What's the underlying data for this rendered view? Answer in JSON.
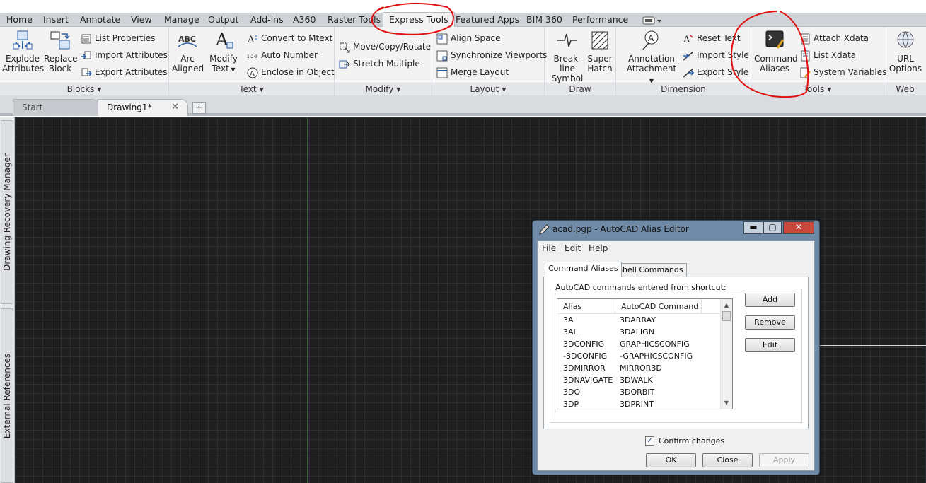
{
  "ribbon_tabs": [
    {
      "label": "Home"
    },
    {
      "label": "Insert"
    },
    {
      "label": "Annotate"
    },
    {
      "label": "View"
    },
    {
      "label": "Manage"
    },
    {
      "label": "Output"
    },
    {
      "label": "Add-ins"
    },
    {
      "label": "A360"
    },
    {
      "label": "Raster Tools"
    },
    {
      "label": "Express Tools",
      "active": true
    },
    {
      "label": "Featured Apps"
    },
    {
      "label": "BIM 360"
    },
    {
      "label": "Performance"
    }
  ],
  "panels": {
    "blocks": {
      "title": "Blocks",
      "explode": "Explode\nAttributes",
      "explode_l1": "Explode",
      "explode_l2": "Attributes",
      "replace_l1": "Replace",
      "replace_l2": "Block",
      "list_properties": "List Properties",
      "import_attributes": "Import Attributes",
      "export_attributes": "Export Attributes"
    },
    "text": {
      "title": "Text",
      "arc_l1": "Arc",
      "arc_l2": "Aligned",
      "modify_l1": "Modify",
      "modify_l2": "Text",
      "convert_mtext": "Convert to Mtext",
      "auto_number": "Auto Number",
      "enclose": "Enclose in Object",
      "abc": "ABC"
    },
    "modify": {
      "title": "Modify",
      "move_copy_rotate": "Move/Copy/Rotate",
      "stretch_multiple": "Stretch Multiple"
    },
    "layout": {
      "title": "Layout",
      "align_space": "Align Space",
      "sync_viewports": "Synchronize Viewports",
      "merge_layout": "Merge Layout"
    },
    "draw": {
      "title": "Draw",
      "breakline_l1": "Break-line",
      "breakline_l2": "Symbol",
      "superhatch_l1": "Super",
      "superhatch_l2": "Hatch"
    },
    "dimension": {
      "title": "Dimension",
      "annotation_l1": "Annotation",
      "annotation_l2": "Attachment",
      "reset_text": "Reset Text",
      "import_style": "Import Style",
      "export_style": "Export Style"
    },
    "tools": {
      "title": "Tools",
      "command_l1": "Command",
      "command_l2": "Aliases",
      "attach_xdata": "Attach Xdata",
      "list_xdata": "List Xdata",
      "system_variables": "System Variables"
    },
    "web": {
      "title": "Web",
      "url_l1": "URL",
      "url_l2": "Options"
    }
  },
  "file_tabs": {
    "start": "Start",
    "drawing": "Drawing1*",
    "close": "✕",
    "plus": "+"
  },
  "palettes": {
    "recovery": "Drawing Recovery Manager",
    "xrefs": "External References"
  },
  "dialog": {
    "title": "acad.pgp - AutoCAD Alias Editor",
    "min": "▬",
    "max": "▢",
    "close": "✕",
    "menu": {
      "file": "File",
      "edit": "Edit",
      "help": "Help"
    },
    "tab_aliases": "Command Aliases",
    "tab_shell": "Shell Commands",
    "group_label": "AutoCAD commands entered from shortcut:",
    "col_alias": "Alias",
    "col_command": "AutoCAD Command",
    "rows": [
      {
        "alias": "3A",
        "command": "3DARRAY"
      },
      {
        "alias": "3AL",
        "command": "3DALIGN"
      },
      {
        "alias": "3DCONFIG",
        "command": "GRAPHICSCONFIG"
      },
      {
        "alias": "-3DCONFIG",
        "command": "-GRAPHICSCONFIG"
      },
      {
        "alias": "3DMIRROR",
        "command": "MIRROR3D"
      },
      {
        "alias": "3DNAVIGATE",
        "command": "3DWALK"
      },
      {
        "alias": "3DO",
        "command": "3DORBIT"
      },
      {
        "alias": "3DP",
        "command": "3DPRINT"
      }
    ],
    "btn_add": "Add",
    "btn_remove": "Remove",
    "btn_edit": "Edit",
    "confirm_label": "Confirm changes",
    "confirm_checked": true,
    "btn_ok": "OK",
    "btn_close": "Close",
    "btn_apply": "Apply"
  },
  "colors": {
    "annotation": "#e01010",
    "canvas": "#1e1e1e",
    "dialog_frame": "#6f8aa6"
  }
}
